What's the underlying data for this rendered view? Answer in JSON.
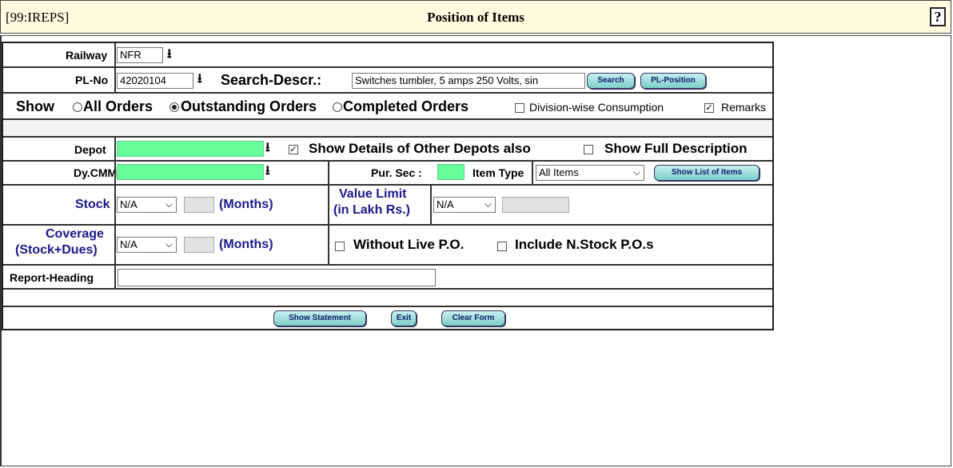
{
  "header": {
    "app_code": "[99:IREPS]",
    "title": "Position of Items",
    "help_icon": "?"
  },
  "railway": {
    "label": "Railway",
    "value": "NFR"
  },
  "plno": {
    "label": "PL-No",
    "value": "42020104",
    "search_label": "Search-Descr.:",
    "search_value": "Switches tumbler, 5 amps 250 Volts, sin",
    "search_button": "Search",
    "plposition_button": "PL-Position"
  },
  "show": {
    "label": "Show",
    "options": [
      "All Orders",
      "Outstanding Orders",
      "Completed Orders"
    ],
    "selected": "Outstanding Orders",
    "division_label": "Division-wise Consumption",
    "division_checked": false,
    "remarks_label": "Remarks",
    "remarks_checked": true
  },
  "depot": {
    "label": "Depot",
    "value": "",
    "other_depots_label": "Show Details of Other Depots also",
    "other_depots_checked": true,
    "full_desc_label": "Show Full Description",
    "full_desc_checked": false
  },
  "dycmm": {
    "label": "Dy.CMM",
    "value": "",
    "pursec_label": "Pur. Sec :",
    "pursec_value": "",
    "itemtype_label": "Item Type",
    "itemtype_value": "All Items",
    "show_list_button": "Show List of Items"
  },
  "stock": {
    "label": "Stock",
    "select_value": "N/A",
    "months_label": "(Months)",
    "value_limit_label1": "Value Limit",
    "value_limit_label2": "(in Lakh Rs.)",
    "value_limit_select": "N/A"
  },
  "coverage": {
    "label1": "Coverage",
    "label2": "(Stock+Dues)",
    "select_value": "N/A",
    "months_label": "(Months)",
    "without_live_label": "Without Live P.O.",
    "include_nstock_label": "Include N.Stock P.O.s"
  },
  "report": {
    "label": "Report-Heading",
    "value": ""
  },
  "actions": {
    "show_statement": "Show Statement",
    "exit": "Exit",
    "clear_form": "Clear Form"
  }
}
